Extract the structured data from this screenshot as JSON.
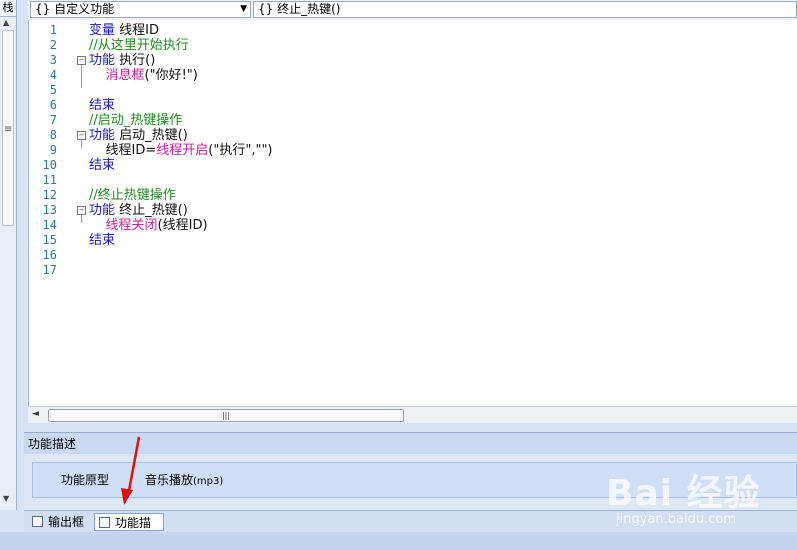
{
  "left_panel": {
    "tab_text": "栈"
  },
  "dropdowns": {
    "function_category": {
      "icon": "{}",
      "value": "自定义功能"
    },
    "function_name": {
      "icon": "{}",
      "value": "终止_热键()"
    }
  },
  "editor": {
    "line_numbers": [
      "1",
      "2",
      "3",
      "4",
      "5",
      "6",
      "7",
      "8",
      "9",
      "10",
      "11",
      "12",
      "13",
      "14",
      "15",
      "16",
      "17"
    ],
    "lines": [
      [
        {
          "t": "变量 ",
          "c": "kw"
        },
        {
          "t": "线程ID",
          "c": "tx"
        }
      ],
      [
        {
          "t": "//从这里开始执行",
          "c": "cm"
        }
      ],
      [
        {
          "t": "功能 ",
          "c": "kw"
        },
        {
          "t": "执行()",
          "c": "tx"
        }
      ],
      [
        {
          "t": "    ",
          "c": "tx"
        },
        {
          "t": "消息框",
          "c": "fn"
        },
        {
          "t": "(\"你好!\")",
          "c": "tx"
        }
      ],
      [],
      [
        {
          "t": "结束",
          "c": "kw"
        }
      ],
      [
        {
          "t": "//启动_热键操作",
          "c": "cm"
        }
      ],
      [
        {
          "t": "功能 ",
          "c": "kw"
        },
        {
          "t": "启动_热键()",
          "c": "tx"
        }
      ],
      [
        {
          "t": "    线程ID=",
          "c": "tx"
        },
        {
          "t": "线程开启",
          "c": "fn"
        },
        {
          "t": "(\"执行\",\"\")",
          "c": "tx"
        }
      ],
      [
        {
          "t": "结束",
          "c": "kw"
        }
      ],
      [],
      [
        {
          "t": "//终止热键操作",
          "c": "cm"
        }
      ],
      [
        {
          "t": "功能 ",
          "c": "kw"
        },
        {
          "t": "终止_热键()",
          "c": "tx"
        }
      ],
      [
        {
          "t": "    ",
          "c": "tx"
        },
        {
          "t": "线程关闭",
          "c": "fn"
        },
        {
          "t": "(线程ID)",
          "c": "tx"
        }
      ],
      [
        {
          "t": "结束",
          "c": "kw"
        }
      ],
      [],
      []
    ],
    "colors": {
      "keyword": "#1a1ab8",
      "comment": "#1f8a1f",
      "builtin": "#c81e9e",
      "line_number": "#2b7c8f"
    }
  },
  "description_panel": {
    "title": "功能描述",
    "prototype_label": "功能原型",
    "prototype_value": "音乐播放",
    "prototype_suffix": "(mp3)"
  },
  "bottom_tabs": [
    {
      "label": "输出框",
      "icon": "output-window-icon",
      "active": false
    },
    {
      "label": "功能描述",
      "icon": "function-description-icon",
      "active": true
    }
  ],
  "watermark": {
    "logo": "Bai 经验",
    "url": "jingyan.baidu.com"
  },
  "annotation": {
    "arrow_color": "#e01010"
  }
}
